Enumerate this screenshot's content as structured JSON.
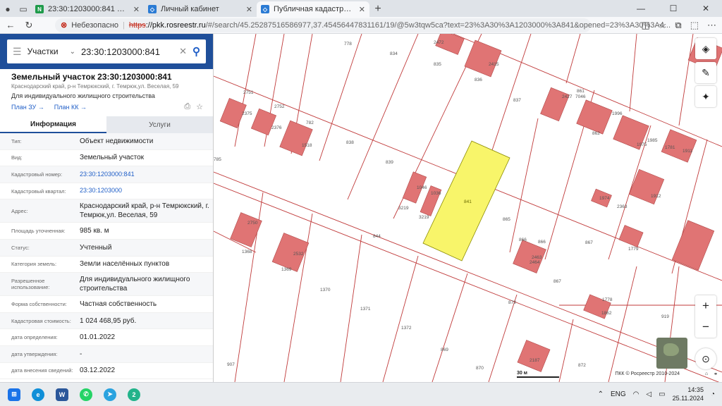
{
  "browser": {
    "tabs": [
      {
        "title": "23:30:1203000:841 Краснодарск",
        "fav_text": "N",
        "fav_color": "#1e9a4a",
        "active": false
      },
      {
        "title": "Личный кабинет",
        "fav_text": "◇",
        "fav_color": "#2b7bd4",
        "active": false
      },
      {
        "title": "Публичная кадастровая карта",
        "fav_text": "◇",
        "fav_color": "#2b7bd4",
        "active": true
      }
    ],
    "new_tab": "+",
    "insecure_label": "Небезопасно",
    "url_protocol": "https",
    "url_host": "://pkk.rosreestr.ru",
    "url_path": "/#/search/45.25287516586977,37.45456447831161/19/@5w3tqw5ca?text=23%3A30%3A1203000%3A841&opened=23%3A30%3A4..."
  },
  "panel": {
    "search": {
      "type_label": "Участки",
      "query": "23:30:1203000:841"
    },
    "title": "Земельный участок 23:30:1203000:841",
    "address_small": "Краснодарский край, р-н Темрюкский, г. Темрюк,ул. Веселая, 59",
    "use_small": "Для индивидуального жилищного строительства",
    "link_zu": "План ЗУ →",
    "link_kk": "План КК →",
    "tab_info": "Информация",
    "tab_services": "Услуги",
    "props": [
      {
        "k": "Тип:",
        "v": "Объект недвижимости",
        "link": false
      },
      {
        "k": "Вид:",
        "v": "Земельный участок",
        "link": false
      },
      {
        "k": "Кадастровый номер:",
        "v": "23:30:1203000:841",
        "link": true
      },
      {
        "k": "Кадастровый квартал:",
        "v": "23:30:1203000",
        "link": true
      },
      {
        "k": "Адрес:",
        "v": "Краснодарский край, р-н Темрюкский, г. Темрюк,ул. Веселая, 59",
        "link": false
      },
      {
        "k": "Площадь уточненная:",
        "v": "985 кв. м",
        "link": false
      },
      {
        "k": "Статус:",
        "v": "Учтенный",
        "link": false
      },
      {
        "k": "Категория земель:",
        "v": "Земли населённых пунктов",
        "link": false
      },
      {
        "k": "Разрешенное использование:",
        "v": "Для индивидуального жилищного строительства",
        "link": false
      },
      {
        "k": "Форма собственности:",
        "v": "Частная собственность",
        "link": false
      },
      {
        "k": "Кадастровая стоимость:",
        "v": "1 024 468,95 руб.",
        "link": false
      },
      {
        "k": "дата определения:",
        "v": "01.01.2022",
        "link": false
      },
      {
        "k": "дата утверждения:",
        "v": "-",
        "link": false
      },
      {
        "k": "дата внесения сведений:",
        "v": "03.12.2022",
        "link": false
      }
    ]
  },
  "map": {
    "scale_label": "30 м",
    "copyright": "ПКК © Росреестр 2010-2024",
    "labels": [
      "778",
      "834",
      "2472",
      "835",
      "2415",
      "836",
      "837",
      "861",
      "7046",
      "2427",
      "1996",
      "862",
      "1985",
      "1975",
      "1781",
      "1911",
      "2751",
      "2752",
      "2375",
      "2376",
      "782",
      "1518",
      "838",
      "839",
      "1046",
      "1036",
      "3219",
      "3219",
      "841",
      "865",
      "866",
      "1974",
      "2363",
      "1912",
      "867",
      "1779",
      "2463",
      "785",
      "2750",
      "1368",
      "1369",
      "2532",
      "844",
      "2464",
      "866",
      "867",
      "1370",
      "1371",
      "879",
      "1778",
      "1862",
      "1372",
      "869",
      "919",
      "870",
      "2187",
      "872",
      "907"
    ],
    "zoom_in": "+",
    "zoom_out": "−"
  },
  "taskbar": {
    "lang": "ENG",
    "time": "14:35",
    "date": "25.11.2024"
  }
}
